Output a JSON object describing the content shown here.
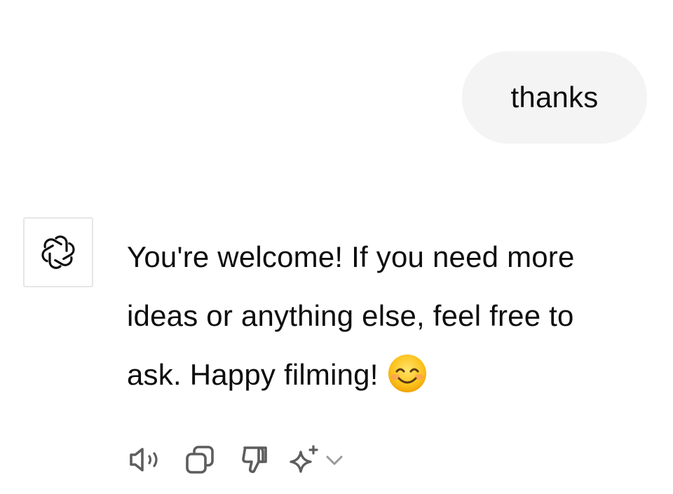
{
  "conversation": {
    "user_message": "thanks",
    "assistant_message": {
      "lines": [
        "You're welcome! If you need more",
        "ideas or anything else, feel free to",
        "ask. Happy filming!"
      ],
      "emoji": "smiling-face-with-smiling-eyes"
    }
  },
  "actions": [
    {
      "icon": "speaker-icon"
    },
    {
      "icon": "copy-icon"
    },
    {
      "icon": "thumbs-down-icon"
    },
    {
      "icon": "sparkle-icon"
    },
    {
      "icon": "chevron-down-icon"
    }
  ],
  "colors": {
    "user_bubble_bg": "#f4f4f4",
    "text": "#0d0d0d",
    "icon": "#5d5d5d",
    "avatar_border": "#e6e6e6"
  }
}
